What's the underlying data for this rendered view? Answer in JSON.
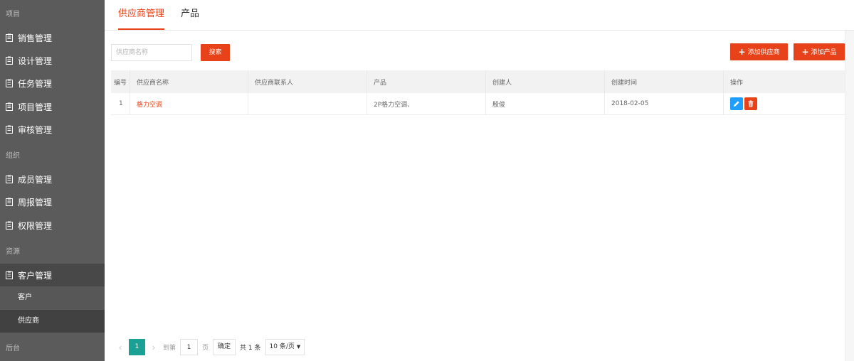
{
  "sidebar": {
    "groups": [
      {
        "label": "项目"
      },
      {
        "label": "组织"
      },
      {
        "label": "资源"
      },
      {
        "label": "后台"
      }
    ],
    "items": [
      {
        "label": "销售管理"
      },
      {
        "label": "设计管理"
      },
      {
        "label": "任务管理"
      },
      {
        "label": "项目管理"
      },
      {
        "label": "审核管理"
      },
      {
        "label": "成员管理"
      },
      {
        "label": "周报管理"
      },
      {
        "label": "权限管理"
      },
      {
        "label": "客户管理"
      }
    ],
    "subitems": [
      {
        "label": "客户"
      },
      {
        "label": "供应商"
      }
    ]
  },
  "tabs": [
    {
      "label": "供应商管理"
    },
    {
      "label": "产品"
    }
  ],
  "toolbar": {
    "search_placeholder": "供应商名称",
    "search_label": "搜索",
    "add_supplier_label": "添加供应商",
    "add_product_label": "添加产品"
  },
  "table": {
    "headers": [
      "编号",
      "供应商名称",
      "供应商联系人",
      "产品",
      "创建人",
      "创建时间",
      "操作"
    ],
    "rows": [
      {
        "id": "1",
        "name": "格力空调",
        "contact": "",
        "product": "2P格力空调、",
        "creator": "殷俊",
        "created": "2018-02-05"
      }
    ]
  },
  "pagination": {
    "prev": "‹",
    "current": "1",
    "next": "›",
    "goto_label": "到第",
    "page_input": "1",
    "page_unit": "页",
    "confirm_label": "确定",
    "total_label": "共 1 条",
    "page_size": "10 条/页",
    "caret": "▼"
  },
  "colors": {
    "accent": "#e7421a",
    "sidebar_bg": "#5b5b5b",
    "pager_current": "#1aa094",
    "edit_button": "#1e9fff"
  }
}
